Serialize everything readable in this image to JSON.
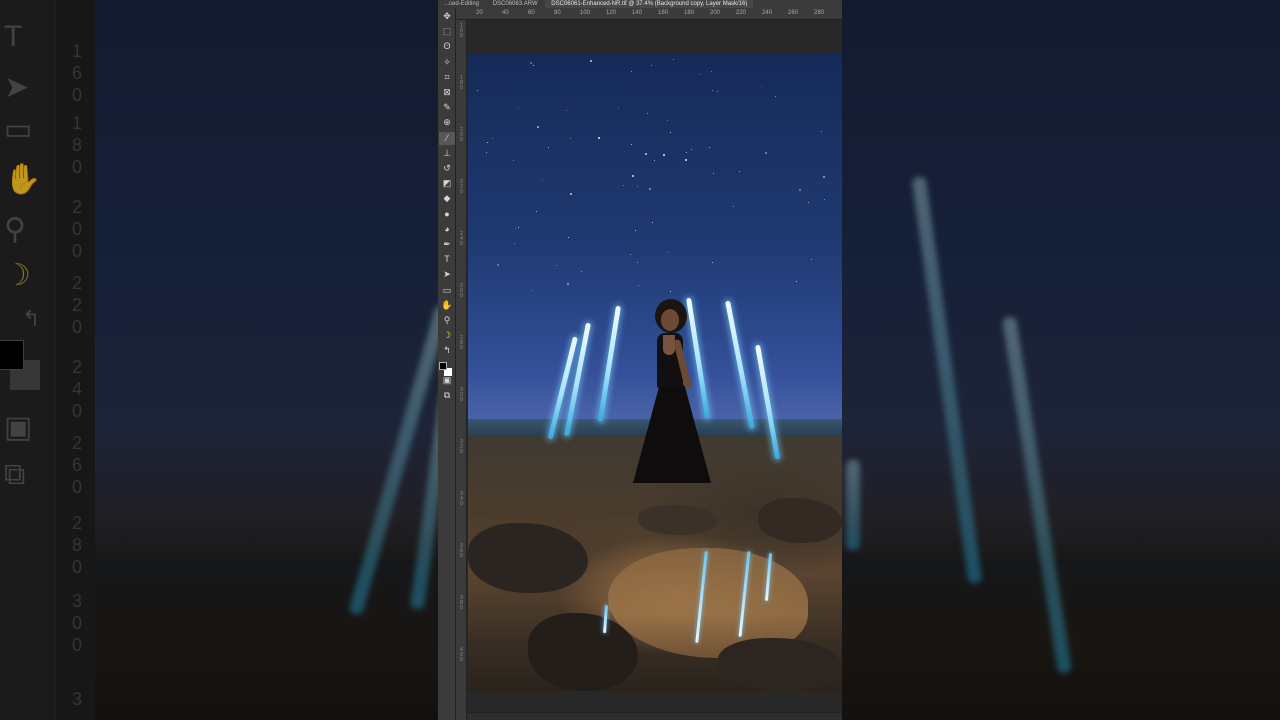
{
  "window": {
    "tabs": [
      {
        "label": "...ced-Editing"
      },
      {
        "label": "DSC06063.ARW"
      },
      {
        "label": "DSC06061-Enhanced-NR.tif @ 37.4% (Background copy, Layer Mask/16)"
      }
    ]
  },
  "toolbar": {
    "tools": [
      {
        "name": "move-tool-icon",
        "glyph": "✥"
      },
      {
        "name": "marquee-tool-icon",
        "glyph": "⬚"
      },
      {
        "name": "lasso-tool-icon",
        "glyph": "ʘ"
      },
      {
        "name": "magic-wand-tool-icon",
        "glyph": "✧"
      },
      {
        "name": "crop-tool-icon",
        "glyph": "⌗"
      },
      {
        "name": "frame-tool-icon",
        "glyph": "⊠"
      },
      {
        "name": "eyedropper-tool-icon",
        "glyph": "✎"
      },
      {
        "name": "healing-brush-tool-icon",
        "glyph": "⊕"
      },
      {
        "name": "brush-tool-icon",
        "glyph": "⁄"
      },
      {
        "name": "clone-stamp-tool-icon",
        "glyph": "⊥"
      },
      {
        "name": "history-brush-tool-icon",
        "glyph": "↺"
      },
      {
        "name": "eraser-tool-icon",
        "glyph": "◩"
      },
      {
        "name": "paint-bucket-tool-icon",
        "glyph": "◆"
      },
      {
        "name": "blur-tool-icon",
        "glyph": "●"
      },
      {
        "name": "dodge-tool-icon",
        "glyph": "◕"
      },
      {
        "name": "pen-tool-icon",
        "glyph": "✒"
      },
      {
        "name": "type-tool-icon",
        "glyph": "T"
      },
      {
        "name": "path-selection-tool-icon",
        "glyph": "➤"
      },
      {
        "name": "rectangle-tool-icon",
        "glyph": "▭"
      },
      {
        "name": "hand-tool-icon",
        "glyph": "✋"
      },
      {
        "name": "zoom-tool-icon",
        "glyph": "⚲"
      },
      {
        "name": "banana-icon",
        "glyph": "☽"
      },
      {
        "name": "swap-colors-icon",
        "glyph": "↰"
      }
    ],
    "extra_tools": [
      {
        "name": "quick-mask-icon",
        "glyph": "▣"
      },
      {
        "name": "screen-mode-icon",
        "glyph": "⧉"
      }
    ]
  },
  "ruler": {
    "horizontal_labels": [
      "20",
      "40",
      "60",
      "80",
      "100",
      "120",
      "140",
      "160",
      "180",
      "200",
      "220",
      "240",
      "260",
      "280"
    ],
    "vertical_labels": [
      "160",
      "180",
      "200",
      "220",
      "240",
      "260",
      "280",
      "300",
      "320",
      "340",
      "360",
      "380",
      "400"
    ]
  },
  "backdrop": {
    "ruler_labels": [
      "160",
      "180",
      "200",
      "220",
      "240",
      "260",
      "280",
      "300",
      "3"
    ]
  },
  "colors": {
    "foreground": "#000000",
    "background": "#ffffff",
    "toolbar": "#3b3b3b",
    "canvas_bg": "#282828"
  }
}
